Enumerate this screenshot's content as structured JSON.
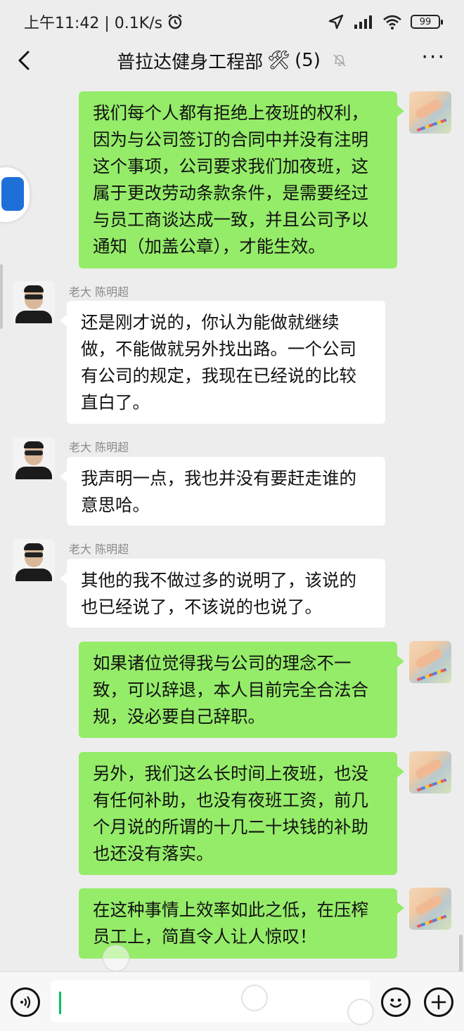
{
  "status_bar": {
    "time_speed": "上午11:42 | 0.1K/s",
    "alarm_icon": "alarm-icon",
    "battery": "99"
  },
  "header": {
    "title": "普拉达健身工程部",
    "tools_emoji": "🛠",
    "member_count": "(5)",
    "more_label": "···"
  },
  "messages": [
    {
      "side": "right",
      "text": "我们每个人都有拒绝上夜班的权利，因为与公司签订的合同中并没有注明这个事项，公司要求我们加夜班，这属于更改劳动条款条件，是需要经过与员工商谈达成一致，并且公司予以通知（加盖公章），才能生效。"
    },
    {
      "side": "left",
      "sender": "老大 陈明超",
      "text": "还是刚才说的，你认为能做就继续做，不能做就另外找出路。一个公司有公司的规定，我现在已经说的比较直白了。"
    },
    {
      "side": "left",
      "sender": "老大 陈明超",
      "text": "我声明一点，我也并没有要赶走谁的意思哈。"
    },
    {
      "side": "left",
      "sender": "老大 陈明超",
      "text": "其他的我不做过多的说明了，该说的也已经说了，不该说的也说了。"
    },
    {
      "side": "right",
      "text": "如果诸位觉得我与公司的理念不一致，可以辞退，本人目前完全合法合规，没必要自己辞职。"
    },
    {
      "side": "right",
      "text": "另外，我们这么长时间上夜班，也没有任何补助，也没有夜班工资，前几个月说的所谓的十几二十块钱的补助也还没有落实。"
    },
    {
      "side": "right",
      "text": "在这种事情上效率如此之低，在压榨员工上，简直令人让人惊叹！"
    }
  ],
  "input_bar": {
    "voice_icon": "voice-icon",
    "emoji_icon": "emoji-icon",
    "plus_icon": "plus-icon",
    "value": ""
  }
}
